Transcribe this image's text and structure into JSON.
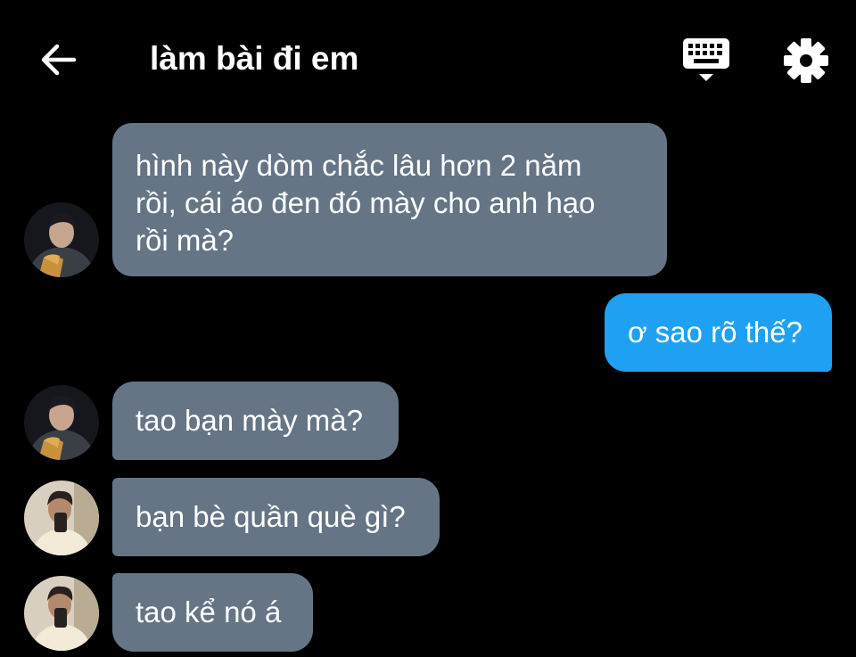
{
  "header": {
    "title": "làm bài đi em",
    "back_icon": "arrow-left-icon",
    "keyboard_icon": "keyboard-icon",
    "settings_icon": "gear-icon"
  },
  "colors": {
    "background": "#000000",
    "incoming_bubble": "#657585",
    "outgoing_bubble": "#1ea1f2",
    "text": "#ffffff"
  },
  "messages": [
    {
      "direction": "incoming",
      "sender_avatar": "avatar-dark-hoodie",
      "lines": [
        "hình này dòm chắc lâu hơn 2 năm",
        "rồi, cái áo đen đó mày cho anh hạo",
        "rồi mà?"
      ]
    },
    {
      "direction": "outgoing",
      "lines": [
        "ơ sao rõ thế?"
      ]
    },
    {
      "direction": "incoming",
      "sender_avatar": "avatar-dark-hoodie",
      "lines": [
        "tao bạn mày mà?"
      ]
    },
    {
      "direction": "incoming",
      "sender_avatar": "avatar-mirror-selfie",
      "lines": [
        "bạn bè quần què gì?"
      ]
    },
    {
      "direction": "incoming",
      "sender_avatar": "avatar-mirror-selfie",
      "lines": [
        "tao kể nó á"
      ]
    }
  ]
}
